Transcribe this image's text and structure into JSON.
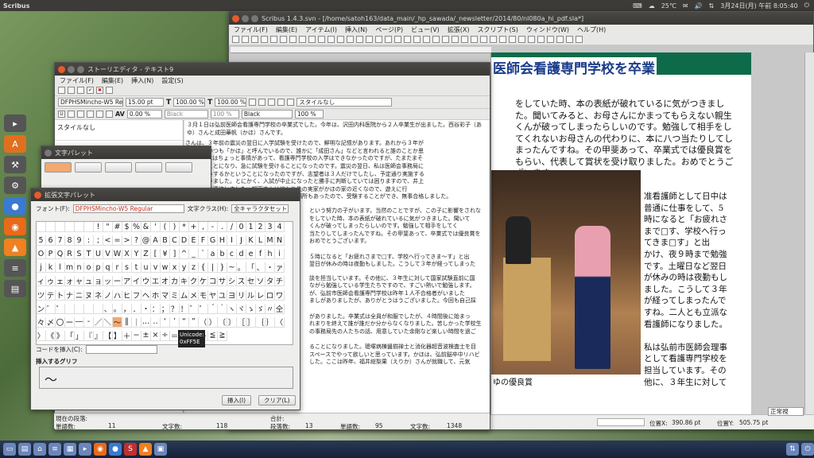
{
  "topbar": {
    "app": "Scribus",
    "temp": "25℃",
    "clock": "3月24日(月) 午前 8:05:40"
  },
  "main_window": {
    "title": "Scribus 1.4.3.svn - [/home/satoh163/data_main/_hp_sawada/_newsletter/2014/80/nl080a_hi_pdf.sla*]",
    "menu": [
      "ファイル(F)",
      "編集(E)",
      "アイテム(I)",
      "挿入(N)",
      "ページ(P)",
      "ビュー(V)",
      "拡張(X)",
      "スクリプト(S)",
      "ウィンドウ(W)",
      "ヘルプ(H)"
    ]
  },
  "doc": {
    "headline": "医師会看護専門学校を卒業",
    "col_top": "をしていた時、本の表紙が破れているに気がつきまし\nた。聞いてみると、お母さんにかまってもらえない親生\nくんが破ってしまったらしいのです。勉強して相手をし\nてくれないお母さんの代わりに、本に八つ当たりしてし\nまったんですね。その甲斐あって、卒業式では優良賞を\nもらい、代表して賞状を受け取りました。おめでとうご\nざいます。",
    "col_right": "准看護師として日中は\n普通に仕事をして、5\n時になると「お疲れさ\nまで□す、学校へ行っ\nてきま□す」と出\nかけ、夜９時まで勉強\nです。土曜日など翌日\nが休みの時は夜勤もし\nました。こうして３年\nが経ってしまったんで\nすね。二人とも立派な\n看護師になりました。\n\n私は弘前市医師会理事\nとして看護専門学校を\n担当しています。その\n他に、３年生に対して",
    "caption": "ゆの優良賞",
    "zoom": "正常視"
  },
  "story_editor": {
    "title": "ストーリエディタ - テキスト9",
    "menu": [
      "ファイル(F)",
      "編集(E)",
      "挿入(N)",
      "設定(S)"
    ],
    "font": "DFPHSMincho-W5 Regular",
    "size": "15.00 pt",
    "scale_w": "100.00 %",
    "scale_h": "100.00 %",
    "style": "スタイルなし",
    "shade1": "Black",
    "shade1_pct": "100 %",
    "shade2": "Black",
    "shade2_pct": "100 %",
    "tracking": "0.00 %",
    "style_name": "スタイルなし",
    "text_first": "３月１日は弘前医師会看護専門学校の卒業式でした。今年は、沢田内科医院から２人卒業生が出ました。西谷彩子（あゆ）さんと成田華帆（かほ）さんです。",
    "text_body": "さんは、３年前の震災の翌日に入学試験を受けたので、鮮明な記憶があります。あれから３年が\nですね。いつも「かほ」と呼んでいるので、誰かに「成田さん」などと言われると誰のことか思\nです。かほはちょっと事情があって、看護専門学校の入学はできなかったのですが、たまたまそ\n集を行うことになり、急に試験を受けることになったのです。震災の翌日、私は医師会事務局に\n入試をどうするかということになったのですが、志望者は３人だけでしたし、予定通り実施する\nことになりました。とにかく、入試が中止になったと勝手に判断していては困りますので、井上\nまで出して連絡しました。卸下さんは嫁入り先の実家がかほの家の近くなので、遊えに行\n様、試験会場で待ったそうですね。勉強する場所もあったので、受験することができ、無事合格しました。",
    "text_mid": "という努力の子がいます。当然のことですが、この子に影響をされな\nをしていた時、本の表紙が破れているに気がつきました。聞いて\nくんが破ってしまったらしいのです。勉強して相手をしてく\n当たりしてしまったんですね。その甲斐あって、卒業式では優良賞を\nおめでとうございます。\n\n５時になると「お疲れさまで□す、学校へ行ってきま〜す」と出\n翌日が休みの時は夜勤もしました。こうして３年が経ってしまった",
    "text_low": "談を担当しています。その他に、３年生に対して国家試験直前に国\nながら勉強している学生たちですので、すごい熱いで勉強します。\nが、弘前市医師会看護専門学校は昨年１人不合格者がいました\nましがありましたが、ありがとうはうございました。今回も自己採\n\nがありました。卒業式は全員が和服でしたが、４時間後に始まっ\nれまりを終えて誰が誰だか分からなくなりました。苦しかった学校生\nの事務局先の人たちの話、用意していた余剛など楽しい時間を過ご\n\nることになりました。聰塚病棟醤揃禅士と消化器超音波検査士を目\nスペースでやって欲しいと思っています。かほは、弘前脳卒中リハビ\nした。ここは昨年、福井総梨果（えりか）さんが就職して、元気",
    "status": {
      "current_para": "現在の段落:",
      "words": "単語数:",
      "words_v": "11",
      "chars": "文字数:",
      "chars_v": "118",
      "total": "合計:",
      "paras": "段落数:",
      "paras_v": "13",
      "words2": "単語数:",
      "words2_v": "95",
      "chars2": "文字数:",
      "chars2_v": "1348"
    }
  },
  "char_palette": {
    "title": "文字パレット"
  },
  "ext_palette": {
    "title": "拡張文字パレット",
    "font_label": "フォント(F):",
    "font": "DFPHSMincho-W5 Regular",
    "class_label": "文字クラス(H):",
    "class": "全キャラクタセット",
    "chars": [
      "",
      "",
      "",
      "",
      "",
      "",
      "!",
      "\"",
      "#",
      "$",
      "%",
      "&",
      "'",
      "(",
      ")",
      "*",
      "+",
      ",",
      "-",
      ".",
      "/",
      "0",
      "1",
      "2",
      "3",
      "4",
      "5",
      "6",
      "7",
      "8",
      "9",
      ":",
      ";",
      "<",
      "=",
      ">",
      "?",
      "@",
      "A",
      "B",
      "C",
      "D",
      "E",
      "F",
      "G",
      "H",
      "I",
      "J",
      "K",
      "L",
      "M",
      "N",
      "O",
      "P",
      "Q",
      "R",
      "S",
      "T",
      "U",
      "V",
      "W",
      "X",
      "Y",
      "Z",
      "[",
      "¥",
      "]",
      "^",
      "_",
      "`",
      "a",
      "b",
      "c",
      "d",
      "e",
      "f",
      "h",
      "i",
      "j",
      "k",
      "l",
      "m",
      "n",
      "o",
      "p",
      "q",
      "r",
      "s",
      "t",
      "u",
      "v",
      "w",
      "x",
      "y",
      "z",
      "{",
      "|",
      "}",
      "~",
      "。",
      "「",
      "、",
      "・",
      "ァ",
      "ィ",
      "ゥ",
      "ェ",
      "ォ",
      "ャ",
      "ュ",
      "ョ",
      "ッ",
      "ー",
      "ア",
      "イ",
      "ウ",
      "エ",
      "オ",
      "カ",
      "キ",
      "ク",
      "ケ",
      "コ",
      "サ",
      "シ",
      "ス",
      "セ",
      "ソ",
      "タ",
      "チ",
      "ツ",
      "テ",
      "ト",
      "ナ",
      "ニ",
      "ヌ",
      "ネ",
      "ノ",
      "ハ",
      "ヒ",
      "フ",
      "ヘ",
      "ホ",
      "マ",
      "ミ",
      "ム",
      "メ",
      "モ",
      "ヤ",
      "ユ",
      "ヨ",
      "リ",
      "ル",
      "レ",
      "ロ",
      "ワ",
      "ン",
      "゛",
      "゜",
      "",
      "",
      "",
      "",
      "、",
      "。",
      "，",
      "．",
      "・",
      "：",
      "；",
      "？",
      "！",
      "゛",
      "゜",
      "´",
      "｀",
      "ヽ",
      "ヾ",
      "ゝ",
      "ゞ",
      "〃",
      "仝",
      "々",
      "〆",
      "〇",
      "ー",
      "―",
      "‐",
      "／",
      "＼",
      "〜",
      "‖",
      "｜",
      "…",
      "‥",
      "‘",
      "’",
      "“",
      "”",
      "（",
      "）",
      "〔",
      "〕",
      "［",
      "］",
      "｛",
      "｝",
      "〈",
      "〉",
      "《",
      "》",
      "「",
      "」",
      "『",
      "』",
      "【",
      "】",
      "＋",
      "−",
      "±",
      "×",
      "÷",
      "＝",
      "≠",
      "＜",
      "＞",
      "≦",
      "≧"
    ],
    "tooltip_line1": "Unicode:",
    "tooltip_line2": "0xFF5E",
    "insert_code_label": "コードを挿入(C):",
    "glyph_label": "挿入するグリフ",
    "glyph": "〜",
    "insert_btn": "挿入(I)",
    "clear_btn": "クリア(L)"
  },
  "main_status": {
    "pos_x_label": "位置X:",
    "pos_x": "390.86 pt",
    "pos_y_label": "位置Y:",
    "pos_y": "505.75 pt"
  }
}
